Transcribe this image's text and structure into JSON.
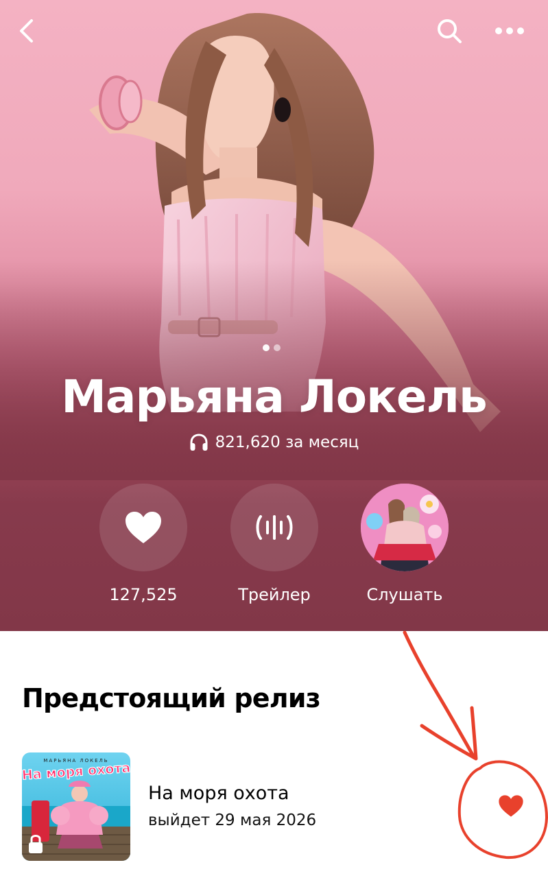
{
  "artist": {
    "name": "Марьяна Локель",
    "monthly_listeners": "821,620 за месяц"
  },
  "actions": {
    "like_count": "127,525",
    "trailer_label": "Трейлер",
    "listen_label": "Слушать"
  },
  "upcoming": {
    "section_title": "Предстоящий релиз",
    "release_title": "На моря охота",
    "release_date": "выйдет 29 мая 2026",
    "cover_artist": "МАРЬЯНА ЛОКЕЛЬ",
    "cover_title": "На моря охота"
  },
  "icons": {
    "back": "chevron-left-icon",
    "search": "search-icon",
    "more": "more-dots-icon",
    "headphones": "headphones-icon",
    "heart": "heart-icon",
    "trailer": "waveform-icon",
    "lock": "lock-icon"
  },
  "colors": {
    "hero_top": "#f4b2c3",
    "hero_bottom": "#823748",
    "annotation_red": "#e8412c",
    "release_heart": "#e8412c"
  },
  "carousel": {
    "pages": 2,
    "current": 1
  }
}
